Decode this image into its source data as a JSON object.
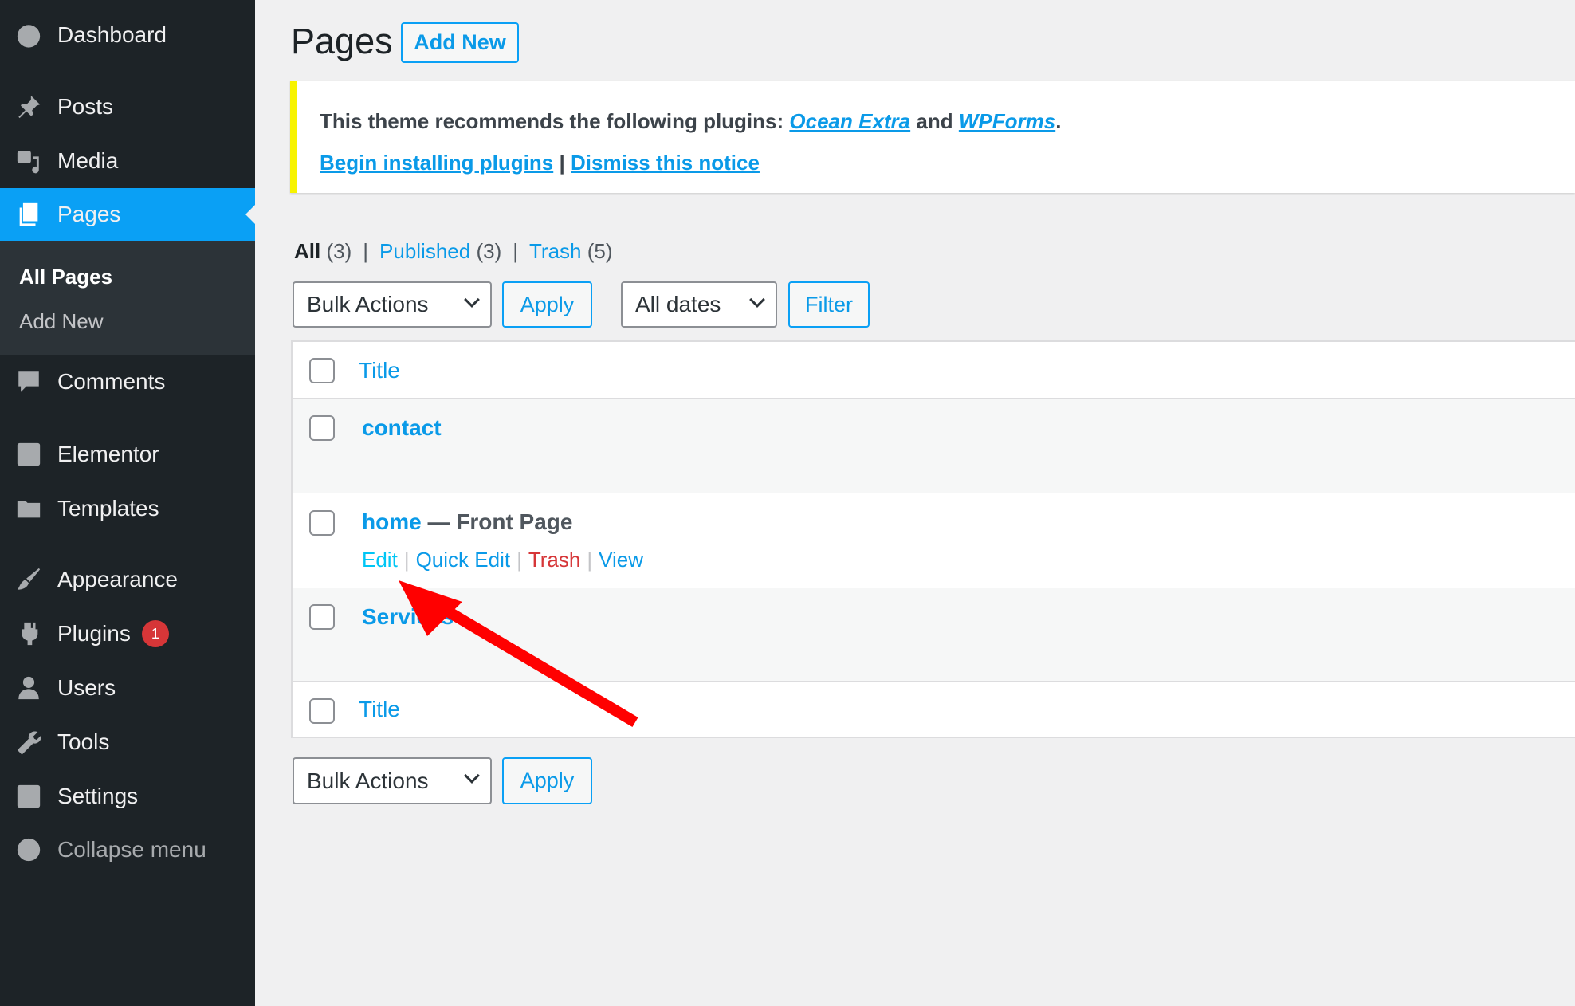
{
  "sidebar": {
    "items": [
      {
        "label": "Dashboard",
        "icon": "dashboard-icon"
      },
      {
        "label": "Posts",
        "icon": "pin-icon"
      },
      {
        "label": "Media",
        "icon": "media-icon"
      },
      {
        "label": "Pages",
        "icon": "pages-icon",
        "active": true
      },
      {
        "label": "Comments",
        "icon": "comment-icon"
      },
      {
        "label": "Elementor",
        "icon": "elementor-icon"
      },
      {
        "label": "Templates",
        "icon": "folder-icon"
      },
      {
        "label": "Appearance",
        "icon": "brush-icon"
      },
      {
        "label": "Plugins",
        "icon": "plugin-icon",
        "badge": "1"
      },
      {
        "label": "Users",
        "icon": "user-icon"
      },
      {
        "label": "Tools",
        "icon": "wrench-icon"
      },
      {
        "label": "Settings",
        "icon": "settings-icon"
      },
      {
        "label": "Collapse menu",
        "icon": "collapse-icon"
      }
    ],
    "submenu": [
      "All Pages",
      "Add New"
    ]
  },
  "header": {
    "title": "Pages",
    "add_new": "Add New"
  },
  "notice": {
    "text": "This theme recommends the following plugins:",
    "plugin1": "Ocean Extra",
    "and": "and",
    "plugin2": "WPForms",
    "period": ".",
    "begin": "Begin installing plugins",
    "sep": "|",
    "dismiss": "Dismiss this notice"
  },
  "filters": {
    "all": "All",
    "all_count": "(3)",
    "published": "Published",
    "published_count": "(3)",
    "trash": "Trash",
    "trash_count": "(5)",
    "sep": "|"
  },
  "toolbar": {
    "bulk": "Bulk Actions",
    "apply": "Apply",
    "dates": "All dates",
    "filter": "Filter"
  },
  "table": {
    "header": "Title",
    "footer": "Title",
    "rows": [
      {
        "title": "contact"
      },
      {
        "title": "home",
        "state": "— Front Page",
        "actions": [
          "Edit",
          "Quick Edit",
          "Trash",
          "View"
        ]
      },
      {
        "title": "Services"
      }
    ]
  },
  "colors": {
    "accent": "#0aa0f5",
    "sidebar": "#1d2327",
    "trash": "#d63638",
    "notice_border": "#f7f300",
    "annotation_arrow": "#ff0000"
  }
}
